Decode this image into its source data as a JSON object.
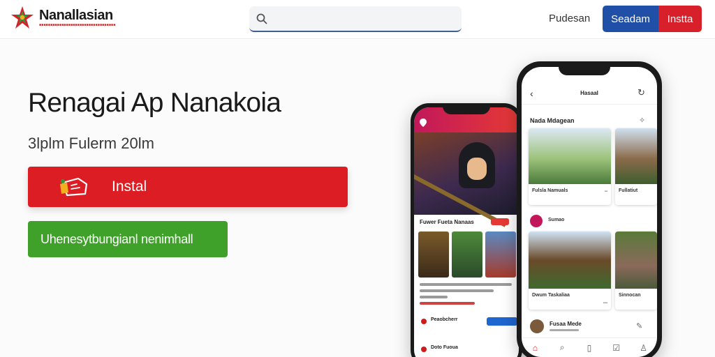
{
  "header": {
    "logo_name": "Nanallasian",
    "search": {
      "placeholder": "",
      "value": ""
    },
    "nav_link": "Pudesan",
    "sign_button": "Seadam",
    "install_button": "Instta"
  },
  "hero": {
    "title": "Renagai Ap Nanakoia",
    "subtitle": "3lplm Fulerm 20lm",
    "install_label": "Instal",
    "learn_label": "Uhenesytbungianl nenimhall"
  },
  "phone_back": {
    "section_title": "Fuwer Fueta Nanaas",
    "row1_label": "Peaobcherr",
    "row2_label": "Doto Fuoua"
  },
  "phone_front": {
    "title": "Hasaal",
    "section_title": "Nada Mdagean",
    "cards": [
      {
        "caption": "Fulsla Namuals"
      },
      {
        "caption": "Fullatiut"
      },
      {
        "caption": "Dwum Taskaliaa"
      },
      {
        "caption": "Sinnocan"
      }
    ],
    "chip_label": "Sumao",
    "user_name": "Fusaa Mede"
  },
  "colors": {
    "brand_red": "#dc1e24",
    "brand_blue": "#1f4fa6",
    "brand_green": "#3fa12a"
  }
}
